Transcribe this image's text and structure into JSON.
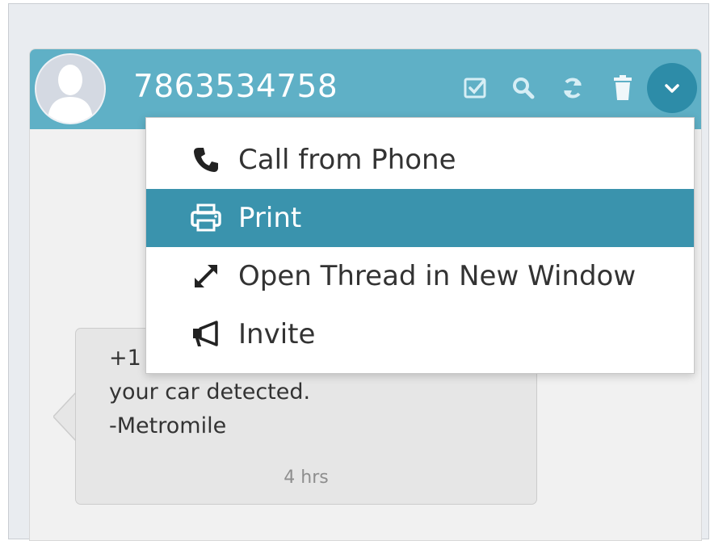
{
  "header": {
    "title": "7863534758",
    "icons": [
      "checkbox-icon",
      "search-icon",
      "refresh-icon",
      "trash-icon",
      "chevron-down-icon"
    ]
  },
  "menu": {
    "items": [
      {
        "label": "Call from Phone",
        "icon": "phone-icon"
      },
      {
        "label": "Print",
        "icon": "print-icon",
        "active": true
      },
      {
        "label": "Open Thread in New Window",
        "icon": "expand-icon"
      },
      {
        "label": "Invite",
        "icon": "megaphone-icon"
      }
    ]
  },
  "message": {
    "lines": [
      "+1",
      "your car detected.",
      "-Metromile"
    ],
    "time": "4 hrs"
  },
  "colors": {
    "header": "#5fb0c6",
    "more_button": "#2d8ca8",
    "menu_active": "#3a93ad"
  }
}
